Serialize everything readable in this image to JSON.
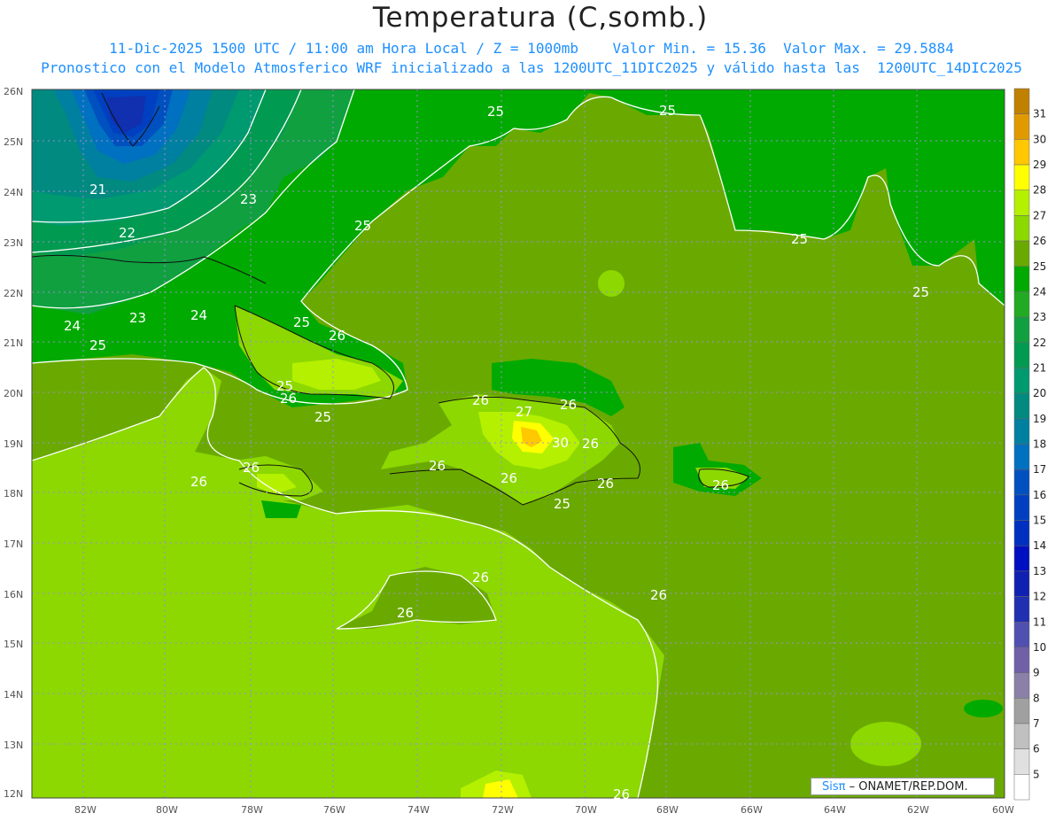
{
  "header": {
    "title": "Temperatura (C,somb.)",
    "line1": "11-Dic-2025 1500 UTC / 11:00 am Hora Local / Z = 1000mb    Valor Min. = 15.36  Valor Max. = 29.5884",
    "line2": "Pronostico con el Modelo Atmosferico WRF inicializado a las 1200UTC_11DIC2025 y válido hasta las  1200UTC_14DIC2025"
  },
  "map": {
    "lat_labels": [
      "26N",
      "25N",
      "24N",
      "23N",
      "22N",
      "21N",
      "20N",
      "19N",
      "18N",
      "17N",
      "16N",
      "15N",
      "14N",
      "13N",
      "12N"
    ],
    "lon_labels": [
      "82W",
      "80W",
      "78W",
      "76W",
      "74W",
      "72W",
      "70W",
      "68W",
      "66W",
      "64W",
      "62W",
      "60W"
    ],
    "contour_labels": [
      {
        "text": "25"
      },
      {
        "text": "25"
      },
      {
        "text": "25"
      },
      {
        "text": "25"
      },
      {
        "text": "21"
      },
      {
        "text": "22"
      },
      {
        "text": "23"
      },
      {
        "text": "23"
      },
      {
        "text": "24"
      },
      {
        "text": "24"
      },
      {
        "text": "25"
      },
      {
        "text": "25"
      },
      {
        "text": "26"
      },
      {
        "text": "25"
      },
      {
        "text": "26"
      },
      {
        "text": "25"
      },
      {
        "text": "25"
      },
      {
        "text": "26"
      },
      {
        "text": "27"
      },
      {
        "text": "26"
      },
      {
        "text": "26"
      },
      {
        "text": "30"
      },
      {
        "text": "26"
      },
      {
        "text": "26"
      },
      {
        "text": "26"
      },
      {
        "text": "25"
      },
      {
        "text": "26"
      },
      {
        "text": "26"
      },
      {
        "text": "26"
      },
      {
        "text": "26"
      },
      {
        "text": "26"
      },
      {
        "text": "26"
      },
      {
        "text": "26"
      }
    ]
  },
  "colorbar": {
    "levels": [
      "31",
      "30",
      "29",
      "28",
      "27",
      "26",
      "25",
      "24",
      "23",
      "22",
      "21",
      "20",
      "19",
      "18",
      "17",
      "16",
      "15",
      "14",
      "13",
      "12",
      "11",
      "10",
      "9",
      "8",
      "7",
      "6",
      "5"
    ],
    "colors": [
      "#c08000",
      "#e09a00",
      "#ffc800",
      "#ffff00",
      "#b4f000",
      "#8cd800",
      "#6aaa00",
      "#00aa00",
      "#22aa22",
      "#10a040",
      "#009a50",
      "#009a70",
      "#008a80",
      "#0080a0",
      "#0070c0",
      "#0050c0",
      "#0040c0",
      "#0030c0",
      "#0010c0",
      "#1020b0",
      "#2030b0",
      "#5050b0",
      "#7060a8",
      "#8a80a8",
      "#a0a0a0",
      "#c0c0c0",
      "#e0e0e0",
      "#ffffff"
    ]
  },
  "credit": {
    "brand": "Sisπ",
    "text": "– ONAMET/REP.DOM."
  }
}
